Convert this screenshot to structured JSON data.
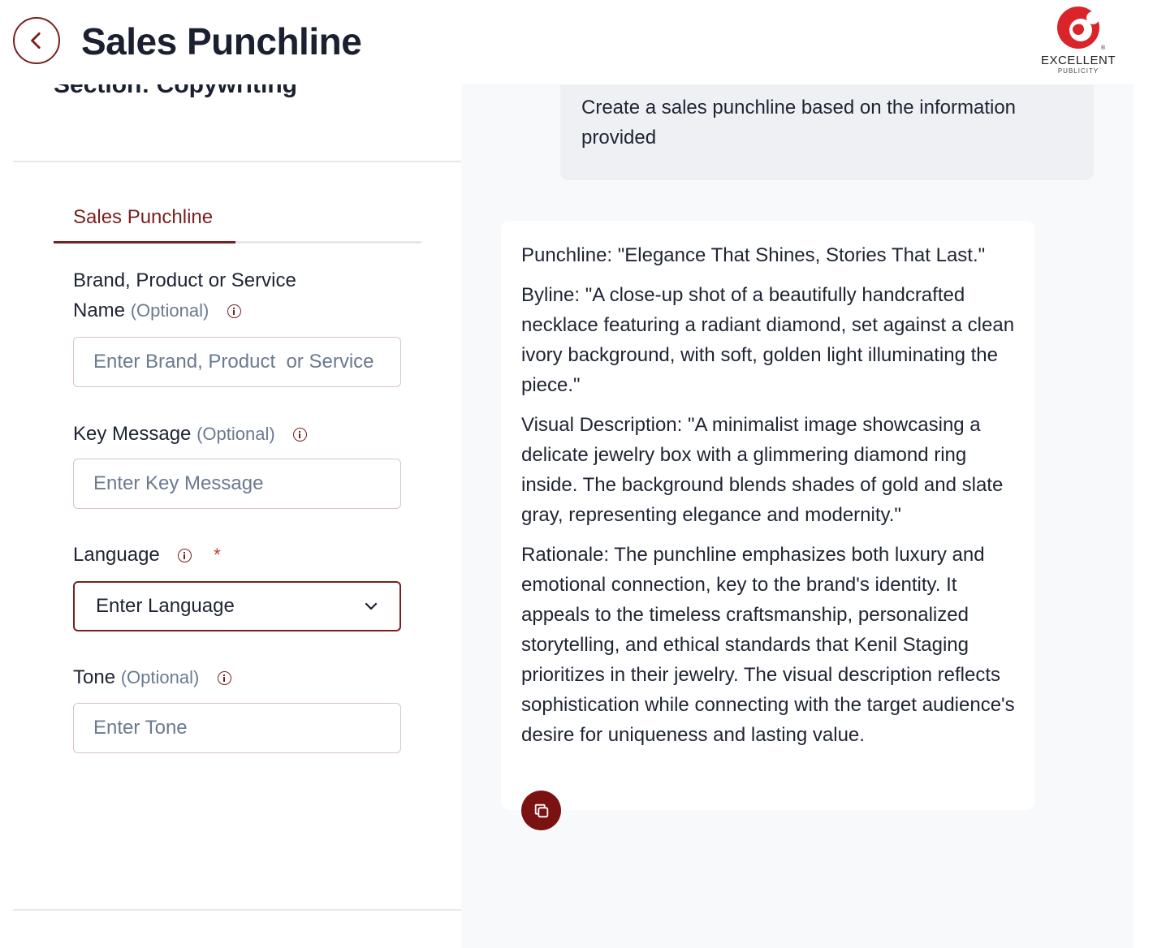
{
  "header": {
    "title": "Sales Punchline",
    "logo": {
      "name": "EXCELLENT",
      "sub": "PUBLICITY",
      "reg": "®",
      "color": "#d9252a"
    }
  },
  "left": {
    "section": "Section: Copywriting",
    "tab": "Sales Punchline",
    "fields": {
      "brand": {
        "label_line1": "Brand, Product or Service",
        "label_line2": "Name",
        "optional": "(Optional)",
        "placeholder": "Enter Brand, Product  or Service"
      },
      "key_message": {
        "label": "Key Message",
        "optional": "(Optional)",
        "placeholder": "Enter Key Message"
      },
      "language": {
        "label": "Language",
        "required": "*",
        "value": "Enter Language"
      },
      "tone": {
        "label": "Tone",
        "optional": "(Optional)",
        "placeholder": "Enter Tone"
      }
    }
  },
  "right": {
    "prompt": "Create a sales punchline based on the information provided",
    "result": {
      "punchline": "Punchline: \"Elegance That Shines, Stories That Last.\"",
      "byline": "Byline: \"A close-up shot of a beautifully handcrafted necklace featuring a radiant diamond, set against a clean ivory background, with soft, golden light illuminating the piece.\"",
      "visual": "Visual Description: \"A minimalist image showcasing a delicate jewelry box with a glimmering diamond ring inside. The background blends shades of gold and slate gray, representing elegance and modernity.\"",
      "rationale": "Rationale: The punchline emphasizes both luxury and emotional connection, key to the brand's identity. It appeals to the timeless craftsmanship, personalized storytelling, and ethical standards that Kenil Staging prioritizes in their jewelry. The visual description reflects sophistication while connecting with the target audience's desire for uniqueness and lasting value."
    }
  },
  "colors": {
    "accent": "#7a1f1f",
    "copy_button": "#7a1212",
    "panel_bg": "#f8f9fb",
    "prompt_bg": "#eef0f4"
  },
  "icons": {
    "back": "chevron-left-icon",
    "info": "info-icon",
    "dropdown": "chevron-down-icon",
    "copy": "copy-icon"
  }
}
